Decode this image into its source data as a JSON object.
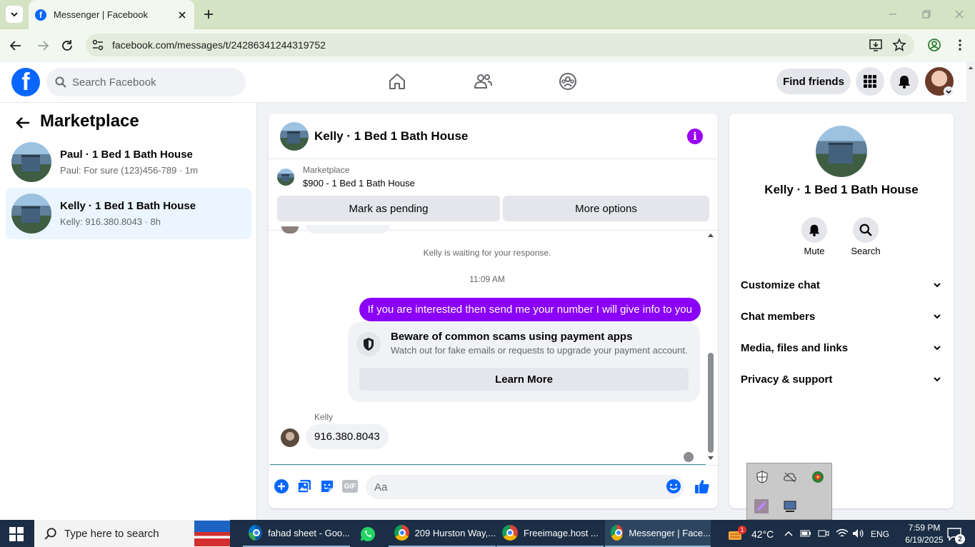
{
  "browser": {
    "tab_title": "Messenger | Facebook",
    "url": "facebook.com/messages/t/24286341244319752"
  },
  "fb_header": {
    "search_placeholder": "Search Facebook",
    "find_friends": "Find friends"
  },
  "left_panel": {
    "title": "Marketplace",
    "conversations": [
      {
        "name": "Paul · 1 Bed 1 Bath House",
        "preview": "Paul: For sure (123)456-789 · 1m"
      },
      {
        "name": "Kelly · 1 Bed 1 Bath House",
        "preview": "Kelly: 916.380.8043 · 8h"
      }
    ]
  },
  "chat": {
    "title": "Kelly · 1 Bed 1 Bath House",
    "marketplace_label": "Marketplace",
    "listing": "$900 - 1 Bed 1 Bath House",
    "mark_pending": "Mark as pending",
    "more_options": "More options",
    "waiting": "Kelly is waiting for your response.",
    "time": "11:09 AM",
    "outgoing": "If you are interested then send me your number I will give info to you",
    "scam_title": "Beware of common scams using payment apps",
    "scam_desc": "Watch out for fake emails or requests to upgrade your payment account.",
    "learn_more": "Learn More",
    "sender": "Kelly",
    "incoming": "916.380.8043",
    "composer_placeholder": "Aa",
    "gif": "GIF"
  },
  "right_panel": {
    "name": "Kelly · 1 Bed 1 Bath House",
    "mute": "Mute",
    "search": "Search",
    "sections": [
      "Customize chat",
      "Chat members",
      "Media, files and links",
      "Privacy & support"
    ]
  },
  "taskbar": {
    "search_placeholder": "Type here to search",
    "apps": [
      "fahad sheet - Goo...",
      "209 Hurston Way,...",
      "Freeimage.host ...",
      "Messenger | Face..."
    ],
    "weather": "42°C",
    "weather_badge": "1",
    "lang": "ENG",
    "time": "7:59 PM",
    "date": "6/19/2025",
    "notif_count": "2"
  },
  "colors": {
    "fb_blue": "#0866ff",
    "purple": "#8a00f8",
    "taskbar": "#1b2e45"
  }
}
